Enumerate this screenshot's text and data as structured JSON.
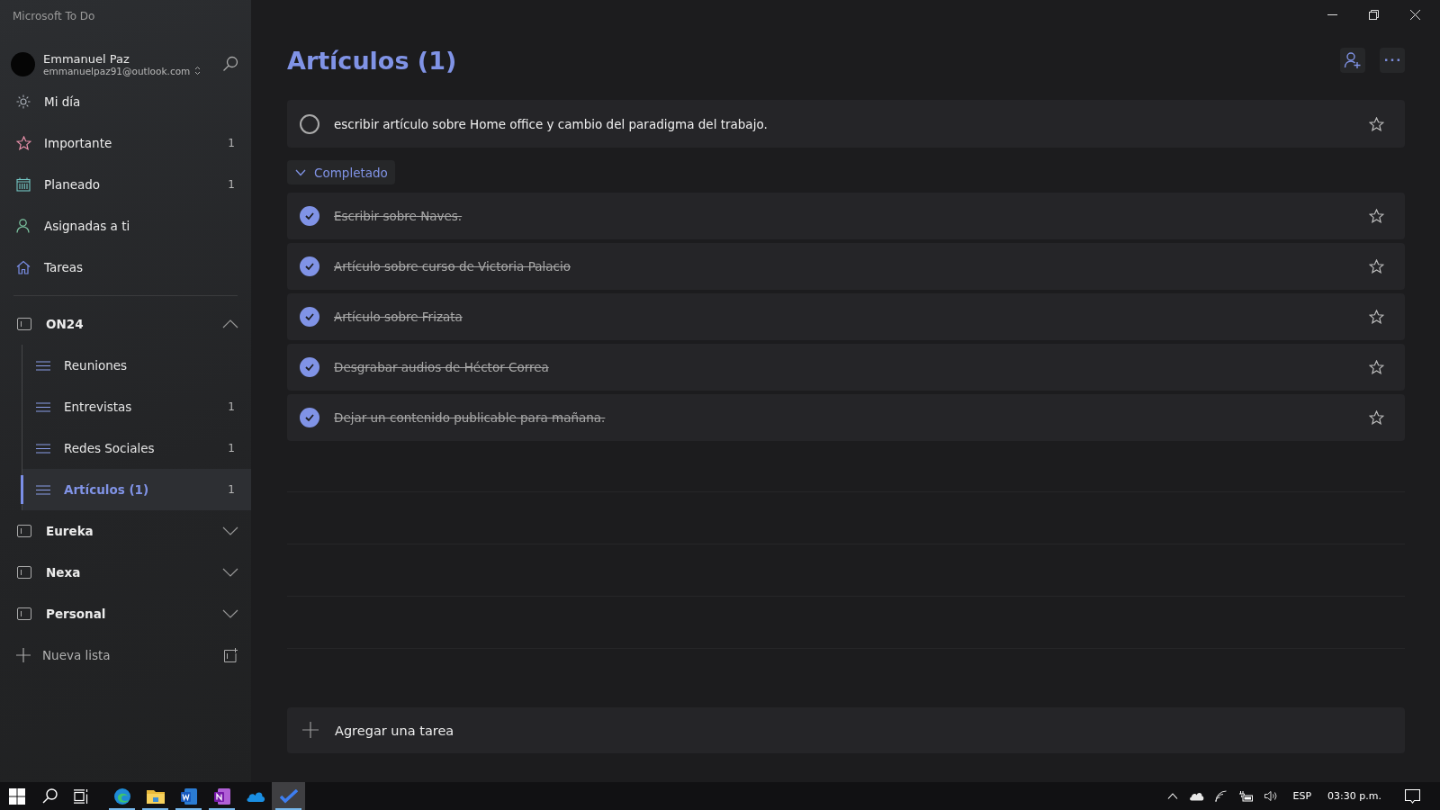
{
  "window": {
    "title": "Microsoft To Do"
  },
  "account": {
    "name": "Emmanuel Paz",
    "email": "emmanuelpaz91@outlook.com"
  },
  "nav": [
    {
      "kind": "sun",
      "label": "Mi día"
    },
    {
      "kind": "star",
      "label": "Importante",
      "count": "1"
    },
    {
      "kind": "calendar",
      "label": "Planeado",
      "count": "1"
    },
    {
      "kind": "person",
      "label": "Asignadas a ti"
    },
    {
      "kind": "home",
      "label": "Tareas"
    }
  ],
  "groups": [
    {
      "label": "ON24",
      "expanded": true,
      "children": [
        {
          "label": "Reuniones",
          "selected": false
        },
        {
          "label": "Entrevistas",
          "count": "1",
          "selected": false
        },
        {
          "label": "Redes Sociales",
          "count": "1",
          "selected": false
        },
        {
          "label": "Artículos (1)",
          "count": "1",
          "selected": true
        }
      ]
    },
    {
      "label": "Eureka",
      "expanded": false
    },
    {
      "label": "Nexa",
      "expanded": false
    },
    {
      "label": "Personal",
      "expanded": false
    }
  ],
  "new_list": {
    "label": "Nueva lista"
  },
  "list_title": "Artículos (1)",
  "tasks": [
    {
      "title": "escribir artículo sobre Home office y cambio del paradigma del trabajo.",
      "completed": false,
      "important": false
    }
  ],
  "completed_section": {
    "label": "Completado",
    "expanded": true,
    "tasks": [
      {
        "title": "Escribir sobre Naves.",
        "completed": true,
        "important": false
      },
      {
        "title": "Artículo sobre curso de Victoria Palacio",
        "completed": true,
        "important": false
      },
      {
        "title": "Artículo sobre Frizata",
        "completed": true,
        "important": false
      },
      {
        "title": "Desgrabar audios de Héctor Correa",
        "completed": true,
        "important": false
      },
      {
        "title": "Dejar un contenido publicable para mañana.",
        "completed": true,
        "important": false
      }
    ]
  },
  "add_task": {
    "placeholder": "Agregar una tarea"
  },
  "taskbar": {
    "apps": [
      {
        "kind": "edge",
        "running": true,
        "active": false
      },
      {
        "kind": "explorer",
        "running": true,
        "active": false
      },
      {
        "kind": "word",
        "running": true,
        "active": false
      },
      {
        "kind": "onenote",
        "running": true,
        "active": false
      },
      {
        "kind": "onedrive",
        "running": false,
        "active": false
      },
      {
        "kind": "todo",
        "running": true,
        "active": true
      }
    ],
    "language": "ESP",
    "time": "03:30 p.m."
  }
}
